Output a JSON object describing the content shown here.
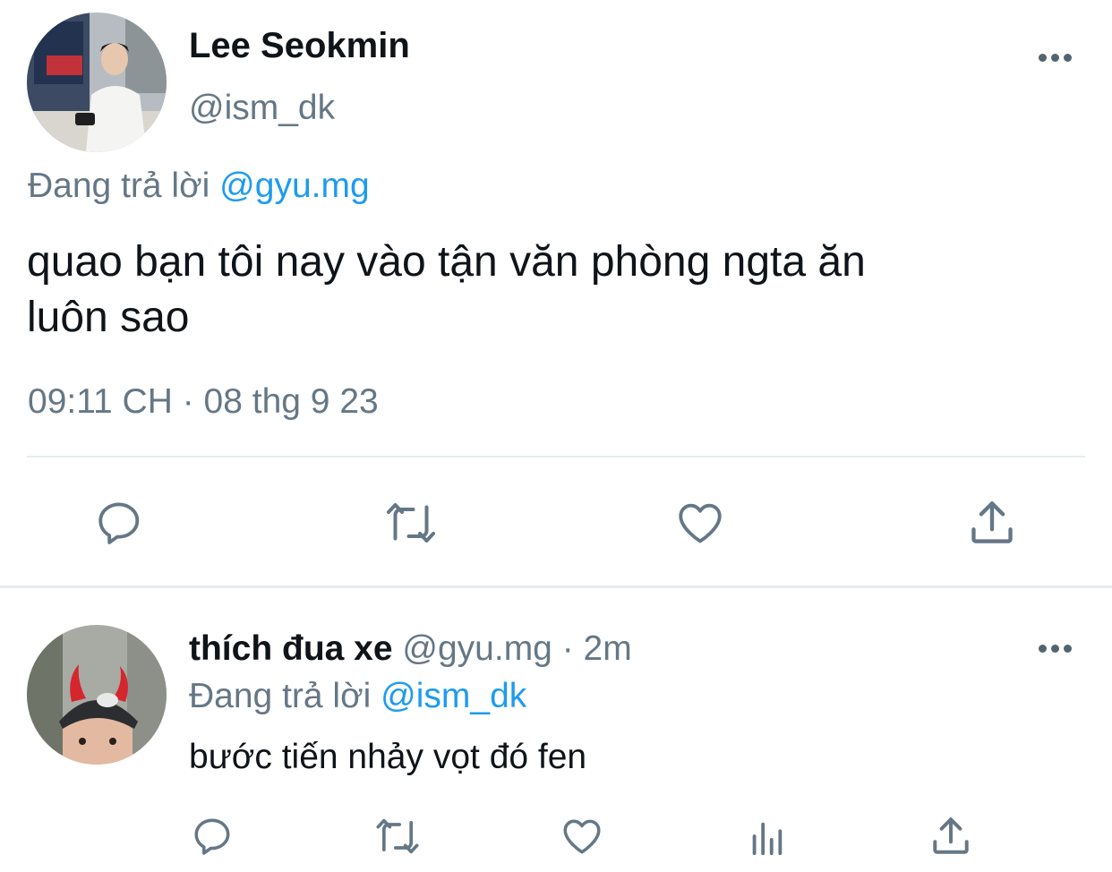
{
  "main_tweet": {
    "display_name": "Lee Seokmin",
    "handle": "@ism_dk",
    "replying_prefix": "Đang trả lời",
    "replying_to": "@gyu.mg",
    "text_line1": "quao bạn tôi nay vào tận văn phòng ngta ăn",
    "text_line2": "luôn sao",
    "timestamp": "09:11 CH · 08 thg 9 23"
  },
  "reply_tweet": {
    "display_name": "thích đua xe",
    "handle": "@gyu.mg",
    "time": "· 2m",
    "replying_prefix": "Đang trả lời",
    "replying_to": "@ism_dk",
    "text": "bước tiến nhảy vọt đó fen"
  },
  "icons": {
    "reply": "speech-bubble-icon",
    "retweet": "retweet-arrows-icon",
    "like": "heart-icon",
    "share": "share-upload-icon",
    "analytics": "bar-chart-icon",
    "more": "more-dots-icon"
  },
  "colors": {
    "link": "#1d9bf0",
    "secondary": "#657786",
    "icon": "#657786"
  }
}
